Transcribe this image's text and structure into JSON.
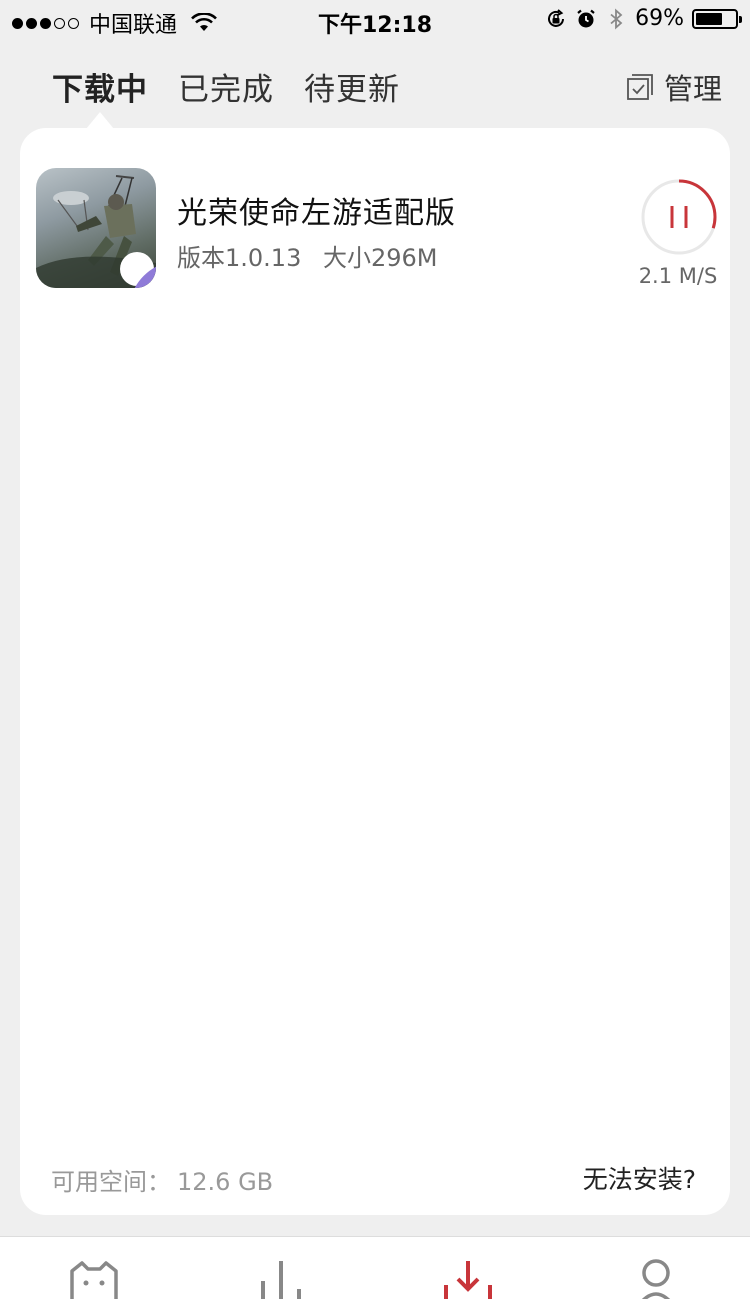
{
  "status_bar": {
    "carrier": "中国联通",
    "time": "下午12:18",
    "battery_percent": "69%",
    "battery_level": 0.69
  },
  "tabs": [
    {
      "label": "下载中",
      "active": true
    },
    {
      "label": "已完成",
      "active": false
    },
    {
      "label": "待更新",
      "active": false
    }
  ],
  "manage": {
    "label": "管理",
    "icon": "checkbox-icon"
  },
  "downloads": [
    {
      "name": "光荣使命左游适配版",
      "version": "版本1.0.13",
      "size": "大小296M",
      "speed": "2.1 M/S",
      "progress": 0.3,
      "icon": "game-icon"
    }
  ],
  "footer": {
    "space_label": "可用空间：",
    "space_value": "12.6 GB",
    "help_link": "无法安装?"
  },
  "bottom_nav": [
    {
      "name": "home",
      "icon": "cat-face-icon"
    },
    {
      "name": "ranking",
      "icon": "bar-chart-icon"
    },
    {
      "name": "download",
      "icon": "download-icon",
      "active": true
    },
    {
      "name": "profile",
      "icon": "person-icon"
    }
  ],
  "colors": {
    "accent": "#c8353a",
    "background": "#efefef",
    "card": "#ffffff"
  }
}
